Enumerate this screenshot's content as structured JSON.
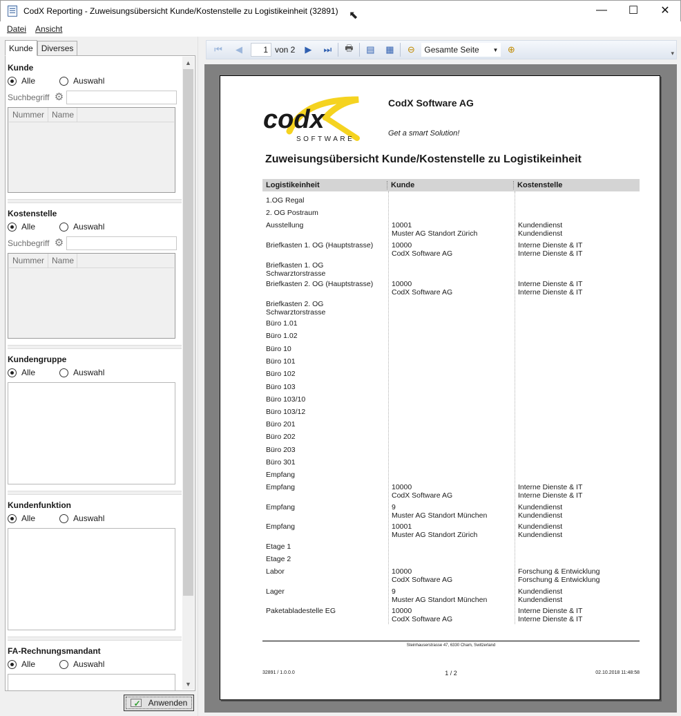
{
  "window": {
    "title": "CodX Reporting - Zuweisungsübersicht Kunde/Kostenstelle zu Logistikeinheit (32891)",
    "minimize": "—",
    "maximize": "☐",
    "close": "✕"
  },
  "menu": {
    "file": "Datei",
    "view": "Ansicht"
  },
  "left": {
    "tabs": [
      "Kunde",
      "Diverses"
    ],
    "customer": {
      "title": "Kunde",
      "all": "Alle",
      "select": "Auswahl",
      "search_label": "Suchbegriff",
      "search_value": "",
      "col_number": "Nummer",
      "col_name": "Name"
    },
    "cost_center": {
      "title": "Kostenstelle",
      "all": "Alle",
      "select": "Auswahl",
      "search_label": "Suchbegriff",
      "search_value": "",
      "col_number": "Nummer",
      "col_name": "Name"
    },
    "customer_group": {
      "title": "Kundengruppe",
      "all": "Alle",
      "select": "Auswahl"
    },
    "customer_function": {
      "title": "Kundenfunktion",
      "all": "Alle",
      "select": "Auswahl"
    },
    "billing_client": {
      "title": "FA-Rechnungsmandant",
      "all": "Alle",
      "select": "Auswahl"
    },
    "apply": "Anwenden"
  },
  "toolbar": {
    "page_current": "1",
    "page_of": "von 2",
    "zoom": "Gesamte Seite",
    "icons": [
      "first-page-icon",
      "prev-page-icon",
      "next-page-icon",
      "last-page-icon",
      "print-icon",
      "export-icon",
      "page-setup-icon",
      "zoom-out-icon",
      "zoom-in-icon"
    ]
  },
  "report": {
    "logo_text": "codx",
    "logo_sub": "SOFTWARE",
    "company": "CodX Software AG",
    "slogan": "Get a smart Solution!",
    "title": "Zuweisungsübersicht Kunde/Kostenstelle zu Logistikeinheit",
    "columns": [
      "Logistikeinheit",
      "Kunde",
      "Kostenstelle"
    ],
    "rows": [
      {
        "unit": "1.OG Regal",
        "customer": "",
        "cost": ""
      },
      {
        "unit": "2. OG Postraum",
        "customer": "",
        "cost": ""
      },
      {
        "unit": "Ausstellung",
        "customer": "10001\nMuster AG Standort Zürich",
        "cost": "Kundendienst\nKundendienst"
      },
      {
        "unit": "Briefkasten 1. OG (Hauptstrasse)",
        "customer": "10000\nCodX Software AG",
        "cost": "Interne Dienste & IT\nInterne Dienste & IT"
      },
      {
        "unit": "Briefkasten 1. OG\nSchwarztorstrasse",
        "customer": "",
        "cost": ""
      },
      {
        "unit": "Briefkasten 2. OG  (Hauptstrasse)",
        "customer": "10000\nCodX Software AG",
        "cost": "Interne Dienste & IT\nInterne Dienste & IT"
      },
      {
        "unit": "Briefkasten 2. OG\nSchwarztorstrasse",
        "customer": "",
        "cost": ""
      },
      {
        "unit": "Büro 1.01",
        "customer": "",
        "cost": ""
      },
      {
        "unit": "Büro 1.02",
        "customer": "",
        "cost": ""
      },
      {
        "unit": "Büro 10",
        "customer": "",
        "cost": ""
      },
      {
        "unit": "Büro 101",
        "customer": "",
        "cost": ""
      },
      {
        "unit": "Büro 102",
        "customer": "",
        "cost": ""
      },
      {
        "unit": "Büro 103",
        "customer": "",
        "cost": ""
      },
      {
        "unit": "Büro 103/10",
        "customer": "",
        "cost": ""
      },
      {
        "unit": "Büro 103/12",
        "customer": "",
        "cost": ""
      },
      {
        "unit": "Büro 201",
        "customer": "",
        "cost": ""
      },
      {
        "unit": "Büro 202",
        "customer": "",
        "cost": ""
      },
      {
        "unit": "Büro 203",
        "customer": "",
        "cost": ""
      },
      {
        "unit": "Büro 301",
        "customer": "",
        "cost": ""
      },
      {
        "unit": "Empfang",
        "customer": "",
        "cost": ""
      },
      {
        "unit": "Empfang",
        "customer": "10000\nCodX Software AG",
        "cost": "Interne Dienste & IT\nInterne Dienste & IT"
      },
      {
        "unit": "Empfang",
        "customer": "9\nMuster AG  Standort München",
        "cost": "Kundendienst\nKundendienst"
      },
      {
        "unit": "Empfang",
        "customer": "10001\nMuster AG Standort Zürich",
        "cost": "Kundendienst\nKundendienst"
      },
      {
        "unit": "Etage 1",
        "customer": "",
        "cost": ""
      },
      {
        "unit": "Etage 2",
        "customer": "",
        "cost": ""
      },
      {
        "unit": "Labor",
        "customer": "10000\nCodX Software AG",
        "cost": "Forschung & Entwicklung\nForschung & Entwicklung"
      },
      {
        "unit": "Lager",
        "customer": "9\nMuster AG  Standort München",
        "cost": "Kundendienst\nKundendienst"
      },
      {
        "unit": "Paketabladestelle EG",
        "customer": "10000\nCodX Software AG",
        "cost": "Interne Dienste & IT\nInterne Dienste & IT"
      }
    ],
    "footer_address": "Steinhauserstrasse 47, 6330 Cham, Switzerland",
    "footer_left": "32891 / 1.0.0.0",
    "footer_page": "1 / 2",
    "footer_right": "02.10.2018 11:48:58"
  },
  "colors": {
    "logo_yellow": "#f5d320",
    "header_gray": "#d4d4d4",
    "viewer_bg": "#808080"
  }
}
